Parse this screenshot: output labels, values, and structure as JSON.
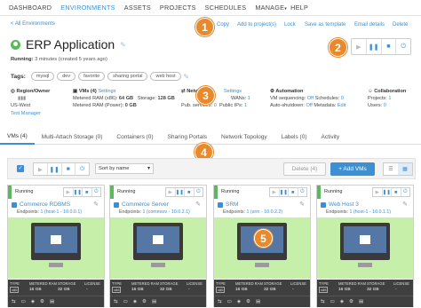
{
  "nav": {
    "items": [
      "DASHBOARD",
      "ENVIRONMENTS",
      "ASSETS",
      "PROJECTS",
      "SCHEDULES",
      "MANAGE",
      "HELP"
    ]
  },
  "back_link": "< All Environments",
  "actions": {
    "copy": "Copy",
    "add_to_projects": "Add to project(s)",
    "lock": "Lock",
    "save_as_template": "Save as template",
    "email_details": "Email details",
    "delete": "Delete"
  },
  "title": "ERP Application",
  "running_label": "Running:",
  "running_text": "3 minutes (created 5 years ago)",
  "tags_label": "Tags:",
  "tags": [
    "mysql",
    "dev",
    "favorite",
    "sharing portal",
    "web host"
  ],
  "callouts": [
    "1",
    "2",
    "3",
    "4",
    "5"
  ],
  "region": {
    "header": "Region/Owner",
    "region": "US-West",
    "owner": "Test Manager"
  },
  "vms": {
    "header": "VMs (4)",
    "settings": "Settings",
    "ram_x86_label": "Metered RAM (x86):",
    "ram_x86": "64 GB",
    "storage_label": "Storage:",
    "storage": "128 GB",
    "ram_power_label": "Metered RAM (Power):",
    "ram_power": "0 GB"
  },
  "network": {
    "header": "Network",
    "settings": "Settings",
    "wans_label": "WANs:",
    "wans": "1",
    "pub_services_label": "Pub. services:",
    "pub_services": "0",
    "public_ips_label": "Public IPs:",
    "public_ips": "1"
  },
  "automation": {
    "header": "Automation",
    "vm_sequencing_label": "VM sequencing:",
    "vm_sequencing": "Off",
    "schedules_label": "Schedules:",
    "schedules": "0",
    "auto_shutdown_label": "Auto-shutdown:",
    "auto_shutdown": "Off",
    "metadata_label": "Metadata:",
    "metadata": "Edit"
  },
  "collaboration": {
    "header": "Collaboration",
    "projects_label": "Projects:",
    "projects": "1",
    "users_label": "Users:",
    "users": "0"
  },
  "tabs": [
    "VMs (4)",
    "Multi-Attach Storage (0)",
    "Containers (0)",
    "Sharing Portals",
    "Network Topology",
    "Labels (0)",
    "Activity"
  ],
  "toolbar": {
    "sort": "Sort by name",
    "delete": "Delete (4)",
    "add_vms": "+ Add VMs"
  },
  "meta_headers": {
    "type": "TYPE",
    "ram": "METERED RAM",
    "storage": "STORAGE",
    "license": "LICENSE"
  },
  "cards": [
    {
      "state": "Running",
      "name": "Commerce RDBMS",
      "endpoints_label": "Endpoints:",
      "endpoint": "1 (host-1 - 10.0.0.1)",
      "os": "x86",
      "ram": "16 GB",
      "storage": "32 GB",
      "license": "-"
    },
    {
      "state": "Running",
      "name": "Commerce Server",
      "endpoints_label": "Endpoints:",
      "endpoint": "1 (commsrv - 10.0.2.1)",
      "os": "x86",
      "ram": "16 GB",
      "storage": "32 GB",
      "license": "-"
    },
    {
      "state": "Running",
      "name": "SRM",
      "endpoints_label": "Endpoints:",
      "endpoint": "1 (srm - 10.0.2.2)",
      "os": "x86",
      "ram": "16 GB",
      "storage": "32 GB",
      "license": "-"
    },
    {
      "state": "Running",
      "name": "Web Host 3",
      "endpoints_label": "Endpoints:",
      "endpoint": "1 (host-1 - 10.0.1.1)",
      "os": "x86",
      "ram": "16 GB",
      "storage": "32 GB",
      "license": "-"
    }
  ]
}
